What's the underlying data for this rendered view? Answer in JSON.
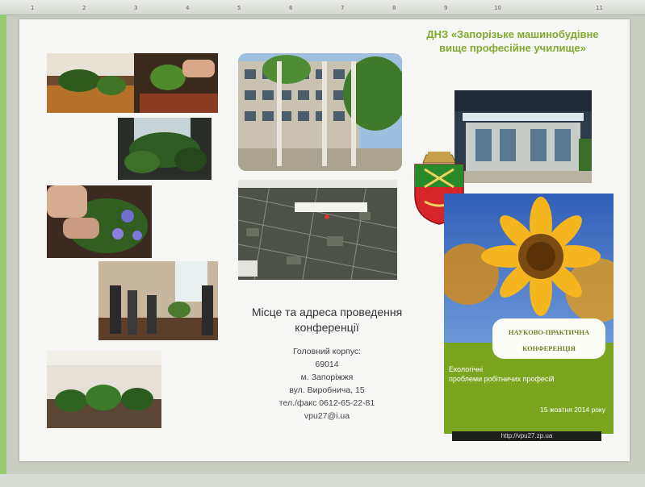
{
  "ruler": {
    "ticks": [
      "1",
      "2",
      "3",
      "4",
      "5",
      "6",
      "7",
      "8",
      "9",
      "10",
      "11"
    ]
  },
  "header": {
    "line1": "ДНЗ «Запорізьке машинобудівне",
    "line2": "вище професійне училище»"
  },
  "venue": {
    "line1": "Місце та адреса проведення",
    "line2": "конференції"
  },
  "address": {
    "building": "Головний корпус:",
    "postcode": "69014",
    "city": "м. Запоріжжя",
    "street": "вул. Виробнича, 15",
    "phone": "тел./факс 0612-65-22-81",
    "email": "vpu27@i.ua"
  },
  "poster": {
    "badge_line1": "НАУКОВО-ПРАКТИЧНА",
    "badge_line2": "КОНФЕРЕНЦІЯ",
    "topic_line1": "Екологічні",
    "topic_line2": "проблеми робітничих професій",
    "date": "15 жовтня 2014 року",
    "url": "http://vpu27.zp.ua"
  },
  "colors": {
    "title_green": "#7faa2e",
    "poster_green": "#7aa51f",
    "sky_blue": "#3b6ec4"
  }
}
